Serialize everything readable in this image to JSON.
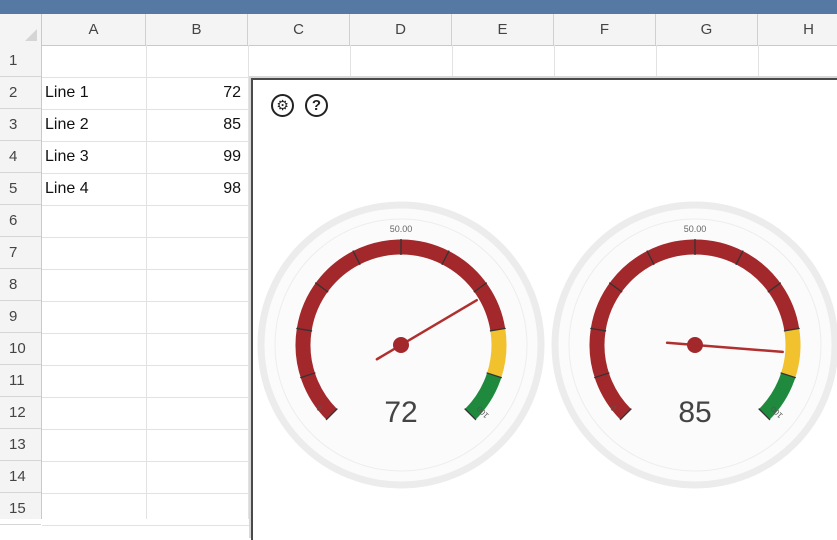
{
  "columns": [
    "A",
    "B",
    "C",
    "D",
    "E",
    "F",
    "G",
    "H"
  ],
  "rows": [
    "1",
    "2",
    "3",
    "4",
    "5",
    "6",
    "7",
    "8",
    "9",
    "10",
    "11",
    "12",
    "13",
    "14",
    "15"
  ],
  "cells": [
    {
      "row": 2,
      "label": "Line 1",
      "value": "72"
    },
    {
      "row": 3,
      "label": "Line 2",
      "value": "85"
    },
    {
      "row": 4,
      "label": "Line 3",
      "value": "99"
    },
    {
      "row": 5,
      "label": "Line 4",
      "value": "98"
    }
  ],
  "toolbar": {
    "settings_icon": "gear-icon",
    "settings_glyph": "⚙",
    "help_icon": "question-icon",
    "help_glyph": "?"
  },
  "colors": {
    "title_strip": "#5579a2",
    "arc_red": "#a3282b",
    "arc_yellow": "#f2c12e",
    "arc_green": "#1f8a3e",
    "needle": "#b03030"
  },
  "chart_data": {
    "type": "gauge",
    "min": 0,
    "max": 100,
    "min_label": "0",
    "mid_label": "50.00",
    "max_label": "100",
    "bands": [
      {
        "from": 0,
        "to": 80,
        "color": "#a3282b"
      },
      {
        "from": 80,
        "to": 90,
        "color": "#f2c12e"
      },
      {
        "from": 90,
        "to": 100,
        "color": "#1f8a3e"
      }
    ],
    "gauges": [
      {
        "value": 72,
        "display": "72"
      },
      {
        "value": 85,
        "display": "85"
      }
    ]
  }
}
